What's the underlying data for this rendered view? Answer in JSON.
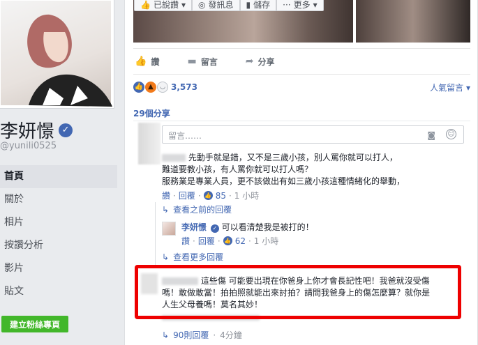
{
  "profile": {
    "name": "李妍憬",
    "username": "@yunili0525"
  },
  "nav": {
    "items": [
      {
        "label": "首頁"
      },
      {
        "label": "關於"
      },
      {
        "label": "相片"
      },
      {
        "label": "按讚分析"
      },
      {
        "label": "影片"
      },
      {
        "label": "貼文"
      }
    ],
    "create_page": "建立粉絲專頁"
  },
  "toolbar": {
    "liked": "已說讚",
    "message": "發訊息",
    "save": "儲存",
    "more": "更多"
  },
  "post_actions": {
    "like": "讚",
    "comment": "留言",
    "share": "分享"
  },
  "reactions": {
    "count": "3,573",
    "sort": "人氣留言"
  },
  "shares": "29個分享",
  "comment_input": {
    "placeholder": "留言……"
  },
  "comments": {
    "c1": {
      "line1": "先動手就是錯，又不是三歲小孩，別人罵你就可以打人，",
      "line2": "難道要教小孩，有人罵你就可以打人嗎？",
      "line3": "服務業是專業人員，更不該做出有如三歲小孩這種情緒化的舉動，",
      "like": "讚",
      "reply": "回覆",
      "likes": "85",
      "time": "1 小時"
    },
    "view_previous": "查看之前的回覆",
    "r1": {
      "author": "李妍憬",
      "text": "可以看清楚我是被打的！",
      "like": "讚",
      "reply": "回覆",
      "likes": "62",
      "time": "1 小時"
    },
    "view_more": "查看更多回覆",
    "c2": {
      "line1": "這些傷 可能要出現在你爸身上你才會長記性吧！我爸就沒受傷",
      "line2": "嗎！敢做敢當！拍拍照就能出來討拍？請問我爸身上的傷怎麼算？就你是",
      "line3": "人生父母養嗎！莫名其妙！",
      "replies": "90則回覆",
      "time": "4分鐘"
    }
  },
  "colors": {
    "link": "#4267b2",
    "highlight": "#ee0000",
    "create_button": "#42b72a"
  }
}
